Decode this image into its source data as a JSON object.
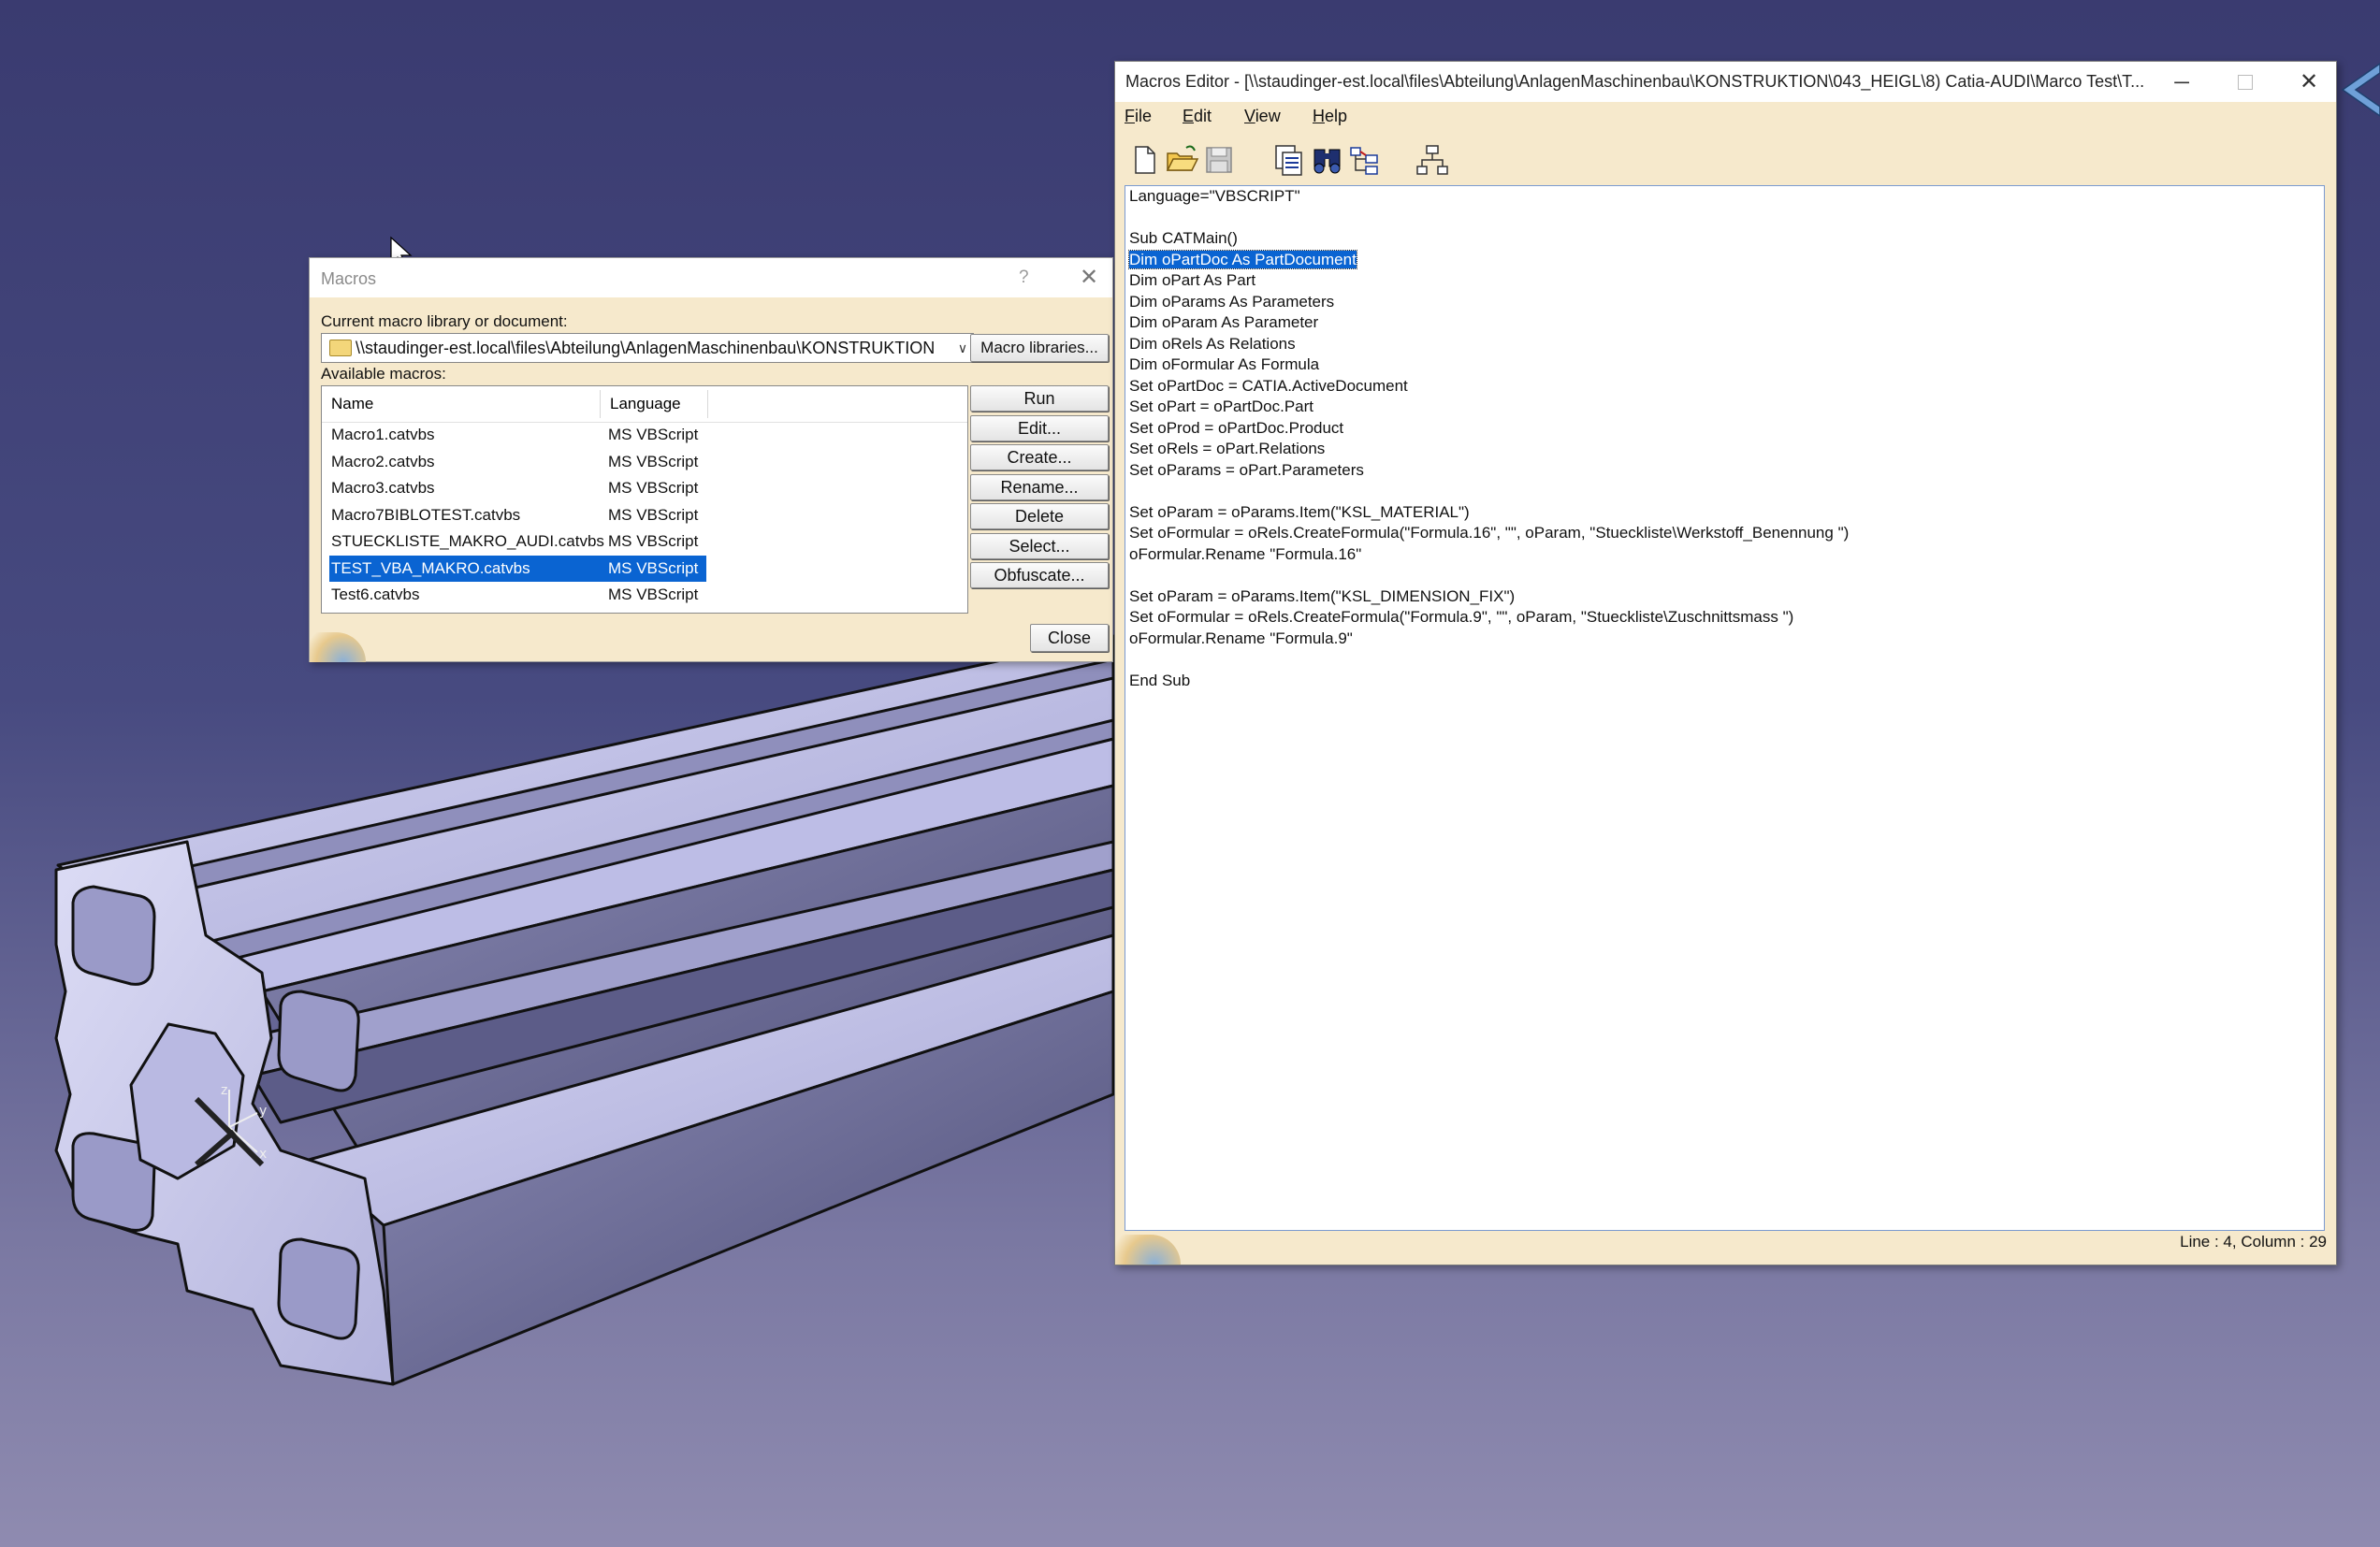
{
  "macros_dialog": {
    "title": "Macros",
    "help_glyph": "?",
    "library_label": "Current macro library or document:",
    "library_value": "\\\\staudinger-est.local\\files\\Abteilung\\AnlagenMaschinenbau\\KONSTRUKTION",
    "available_label": "Available macros:",
    "columns": {
      "name": "Name",
      "language": "Language"
    },
    "rows": [
      {
        "name": "Macro1.catvbs",
        "language": "MS VBScript"
      },
      {
        "name": "Macro2.catvbs",
        "language": "MS VBScript"
      },
      {
        "name": "Macro3.catvbs",
        "language": "MS VBScript"
      },
      {
        "name": "Macro7BIBLOTEST.catvbs",
        "language": "MS VBScript"
      },
      {
        "name": "STUECKLISTE_MAKRO_AUDI.catvbs",
        "language": "MS VBScript"
      },
      {
        "name": "TEST_VBA_MAKRO.catvbs",
        "language": "MS VBScript"
      },
      {
        "name": "Test6.catvbs",
        "language": "MS VBScript"
      }
    ],
    "selected_index": 5,
    "buttons": {
      "macro_libraries": "Macro libraries...",
      "run": "Run",
      "edit": "Edit...",
      "create": "Create...",
      "rename": "Rename...",
      "delete": "Delete",
      "select": "Select...",
      "obfuscate": "Obfuscate...",
      "close": "Close"
    }
  },
  "editor": {
    "title": "Macros Editor - [\\\\staudinger-est.local\\files\\Abteilung\\AnlagenMaschinenbau\\KONSTRUKTION\\043_HEIGL\\8) Catia-AUDI\\Marco Test\\T...",
    "menu": [
      "File",
      "Edit",
      "View",
      "Help"
    ],
    "code_lines": [
      "Language=\"VBSCRIPT\"",
      "",
      "Sub CATMain()",
      "Dim oPartDoc As PartDocument",
      "Dim oPart As Part",
      "Dim oParams As Parameters",
      "Dim oParam As Parameter",
      "Dim oRels As Relations",
      "Dim oFormular As Formula",
      "Set oPartDoc = CATIA.ActiveDocument",
      "Set oPart = oPartDoc.Part",
      "Set oProd = oPartDoc.Product",
      "Set oRels = oPart.Relations",
      "Set oParams = oPart.Parameters",
      "",
      "Set oParam = oParams.Item(\"KSL_MATERIAL\")",
      "Set oFormular = oRels.CreateFormula(\"Formula.16\", \"\", oParam, \"Stueckliste\\Werkstoff_Benennung \")",
      "oFormular.Rename \"Formula.16\"",
      "",
      "Set oParam = oParams.Item(\"KSL_DIMENSION_FIX\")",
      "Set oFormular = oRels.CreateFormula(\"Formula.9\", \"\", oParam, \"Stueckliste\\Zuschnittsmass \")",
      "oFormular.Rename \"Formula.9\"",
      "",
      "End Sub"
    ],
    "selected_line": 3,
    "status": "Line : 4, Column : 29"
  },
  "colors": {
    "selection": "#0a64d2",
    "dialog_bg": "#f6e9cc",
    "profile_light": "#c9c9ec",
    "profile_dark": "#6c6c96"
  }
}
